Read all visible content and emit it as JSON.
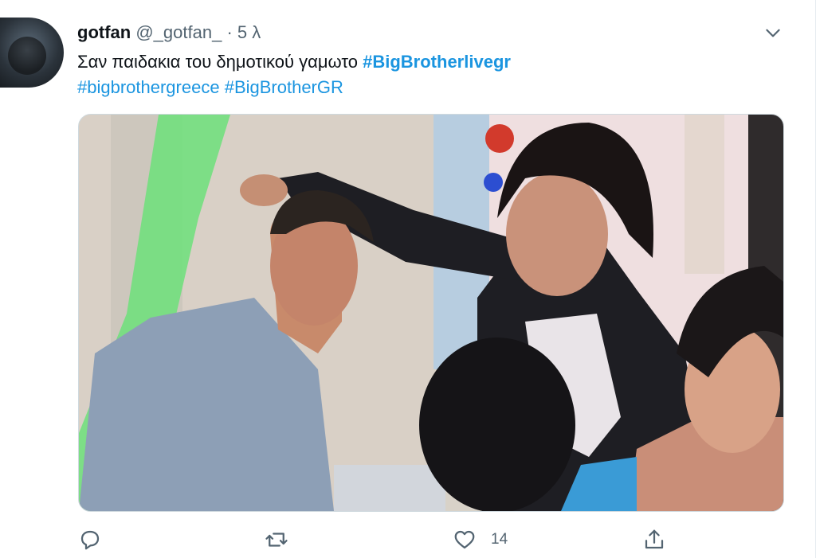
{
  "tweet": {
    "display_name": "gotfan",
    "handle": "@_gotfan_",
    "separator": "·",
    "time": "5 λ",
    "text": "Σαν παιδακια του δημοτικού γαμωτο",
    "hashtags": [
      "#BigBrotherlivegr",
      "#bigbrothergreece",
      "#BigBrotherGR"
    ]
  },
  "actions": {
    "reply_count": "",
    "retweet_count": "",
    "like_count": "14"
  },
  "colors": {
    "hashtag": "#1b95e0",
    "secondary_text": "#536471"
  },
  "icons": {
    "more": "chevron-down-icon",
    "reply": "reply-icon",
    "retweet": "retweet-icon",
    "like": "heart-icon",
    "share": "share-icon"
  }
}
